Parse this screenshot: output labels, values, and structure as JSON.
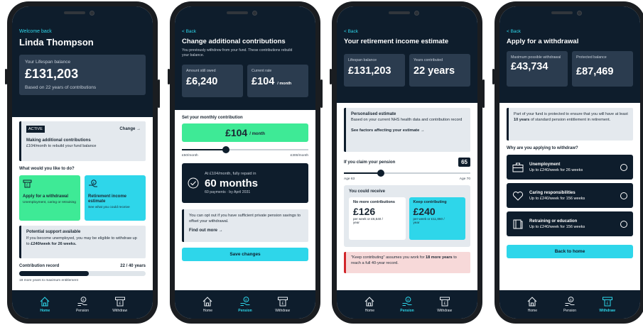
{
  "colors": {
    "navy": "#0e1d2c",
    "tile": "#2b3c4f",
    "accent_cyan": "#2ed6ea",
    "accent_green": "#3eea96",
    "warning_red": "#d2262b"
  },
  "nav": {
    "home": "Home",
    "pension": "Pension",
    "withdraw": "Withdraw"
  },
  "screen1": {
    "welcome": "Welcome back",
    "name": "Linda Thompson",
    "balance_label": "Your Lifespan balance",
    "balance": "£131,203",
    "balance_note": "Based on 22 years of contributions",
    "active_badge": "ACTIVE",
    "change_link": "Change →",
    "contrib_title": "Making additional contributions",
    "contrib_desc": "£104/month to rebuild your fund balance",
    "question": "What would you like to do?",
    "withdrawal_tile": {
      "title": "Apply for a withdrawal",
      "desc": "Unemployment, caring or retraining"
    },
    "estimate_tile": {
      "title": "Retirement income estimate",
      "desc": "See what you could receive"
    },
    "support_title": "Potential support available",
    "support_text": "If you become unemployed, you may be eligible to withdraw up to ",
    "support_bold": "£240/week for 26 weeks.",
    "record_label": "Contribution record",
    "record_value": "22 / 40 years",
    "record_progress": 0.55,
    "record_note": "18 more years to maximum entitlement"
  },
  "screen2": {
    "back": "< Back",
    "title": "Change additional contributions",
    "subtitle": "You previously withdrew from your fund. These contributions rebuild your balance.",
    "owed_label": "Amount still owed",
    "owed": "£6,240",
    "rate_label": "Current rate",
    "rate": "£104",
    "rate_unit": "/ month",
    "set_label": "Set your monthly contribution",
    "monthly": "£104",
    "monthly_unit": "/ month",
    "slider_level": 0.35,
    "slider_min": "£50/month",
    "slider_max": "£300/month",
    "repay_caption": "At £104/month, fully repaid in",
    "repay_months": "60 months",
    "repay_note": "60 payments · by April 2031",
    "optout_text": "You can opt out if you have sufficient private pension savings to offset your withdrawal.",
    "find_out": "Find out more →",
    "save": "Save changes"
  },
  "screen3": {
    "back": "< Back",
    "title": "Your retirement income estimate",
    "balance_label": "Lifespan balance",
    "balance": "£131,203",
    "years_label": "Years contributed",
    "years": "22 years",
    "personal_title": "Personalised estimate",
    "personal_text": "Based on your current NHS health data and contribution record",
    "factors_link": "See factors affecting your estimate →",
    "claim_label": "If you claim your pension",
    "claim_age": "65",
    "slider_level": 0.29,
    "age_min": "Age 63",
    "age_max": "Age 70",
    "receive_label": "You could receive",
    "no_more_label": "No more contributions",
    "no_more_value": "£126",
    "no_more_note": "per week or £6,540 / year",
    "keep_label": "Keep contributing",
    "keep_value": "£240",
    "keep_note": "per week or £11,860 / year",
    "note_text": "\"Keep contributing\" assumes you work for ",
    "note_bold": "18 more years",
    "note_end": " to reach a full 40-year record."
  },
  "screen4": {
    "back": "< Back",
    "title": "Apply for a withdrawal",
    "max_label": "Maximum possible withdrawal",
    "max": "£43,734",
    "protected_label": "Protected balance",
    "protected": "£87,469",
    "info_pre": "Part of your fund is protected to ensure that you will have at least ",
    "info_bold": "10 years",
    "info_post": " of standard pension entitlement in retirement.",
    "why": "Why are you applying to withdraw?",
    "options": [
      {
        "title": "Unemployment",
        "desc": "Up to £240/week for 26 weeks"
      },
      {
        "title": "Caring responsibilities",
        "desc": "Up to £240/week for 156 weeks"
      },
      {
        "title": "Retraining or education",
        "desc": "Up to £240/week for 156 weeks"
      }
    ],
    "back_home": "Back to home"
  }
}
